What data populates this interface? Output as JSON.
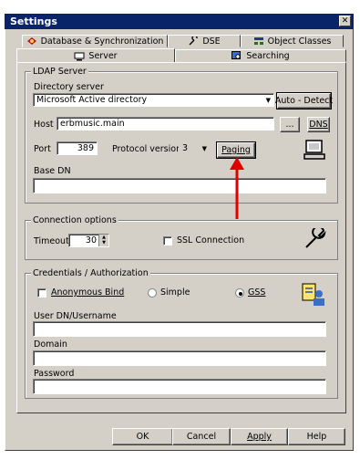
{
  "window": {
    "title": "Settings",
    "close_glyph": "✕"
  },
  "tabs": {
    "row1": [
      {
        "label": "Database & Synchronization",
        "icon": "database-sync-icon"
      },
      {
        "label": "DSE",
        "icon": "wrench-icon"
      },
      {
        "label": "Object Classes",
        "icon": "object-classes-icon"
      }
    ],
    "row2": [
      {
        "label": "Server",
        "icon": "server-icon",
        "active": true
      },
      {
        "label": "Searching",
        "icon": "search-icon"
      }
    ]
  },
  "ldap": {
    "legend": "LDAP Server",
    "directory_label": "Directory server",
    "directory_value": "Microsoft Active directory",
    "auto_detect": "Auto - Detect",
    "host_label": "Host",
    "host_value": "erbmusic.main",
    "browse": "...",
    "dns": "DNS",
    "port_label": "Port",
    "port_value": "389",
    "protocol_label": "Protocol version",
    "protocol_value": "3",
    "paging": "Paging",
    "basedn_label": "Base DN",
    "basedn_value": ""
  },
  "connection": {
    "legend": "Connection options",
    "timeout_label": "Timeout",
    "timeout_value": "30",
    "ssl_label": "SSL Connection",
    "ssl_checked": false
  },
  "credentials": {
    "legend": "Credentials / Authorization",
    "anonymous_label": "Anonymous Bind",
    "simple_label": "Simple",
    "gss_label": "GSS",
    "selected": "GSS",
    "user_label": "User DN/Username",
    "user_value": "",
    "domain_label": "Domain",
    "domain_value": "",
    "password_label": "Password",
    "password_value": ""
  },
  "buttons": {
    "ok": "OK",
    "cancel": "Cancel",
    "apply": "Apply",
    "help": "Help"
  },
  "annotation": {
    "arrow_color": "#e00000"
  }
}
